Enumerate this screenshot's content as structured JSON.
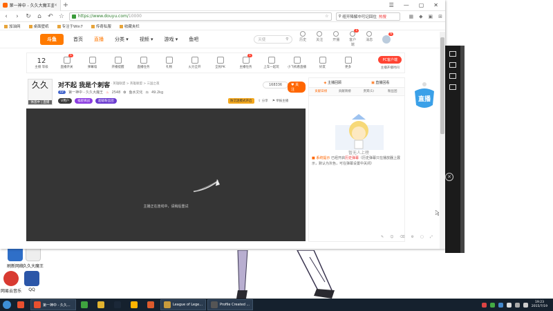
{
  "browser": {
    "tab_title": "第一神中 - 久久大魔王直播_斗鱼...",
    "new_tab": "+",
    "url_host": "https://www.douyu.com/",
    "url_path": "10000",
    "search_text": "纽开降解中可记回住",
    "search_hot": "热搜",
    "bookmarks": [
      "加油网",
      "桌面壁纸",
      "专注于Win7",
      "传奇私服",
      "收藏夹栏"
    ]
  },
  "site": {
    "logo_text": "斗鱼",
    "nav": [
      "首页",
      "直播",
      "分类 ▾",
      "视频 ▾",
      "游戏 ▾",
      "鱼吧"
    ],
    "search_placeholder": "天使",
    "header_icons": [
      {
        "label": "历史",
        "badge": ""
      },
      {
        "label": "关注",
        "badge": ""
      },
      {
        "label": "开播",
        "badge": ""
      },
      {
        "label": "客户端",
        "badge": "1"
      },
      {
        "label": "消息",
        "badge": ""
      }
    ],
    "avatar_badge": "6"
  },
  "toolbar": {
    "level_num": "12",
    "level_label": "主播 等级",
    "tools": [
      {
        "label": "直播开关",
        "badge": "1"
      },
      {
        "label": "弹幕墙",
        "badge": ""
      },
      {
        "label": "开播提醒",
        "badge": ""
      },
      {
        "label": "直播任务",
        "badge": ""
      },
      {
        "label": "礼物",
        "badge": ""
      },
      {
        "label": "火力全开",
        "badge": ""
      },
      {
        "label": "全民PK",
        "badge": ""
      },
      {
        "label": "主播任务",
        "badge": "1"
      },
      {
        "label": "上车一起玩",
        "badge": ""
      },
      {
        "label": "小飞机看直播",
        "badge": ""
      },
      {
        "label": "好友",
        "badge": ""
      },
      {
        "label": "更多",
        "badge": ""
      }
    ],
    "pc_button": "PC客户端",
    "pc_sub": "主播开播时间"
  },
  "room": {
    "avatar_chars": "久久",
    "avatar_status": "休息中 | 直播",
    "title": "对不起 我是个刺客",
    "categories": "举报 · 英雄联盟 > 英雄联盟 > 三国之夜",
    "level_tag": "LV",
    "streamer": "第一神中 - 久久大魔王",
    "heat": "2548",
    "fish": "鱼水文化",
    "weight": "49.2kg",
    "pill_v": "V用户",
    "pill_1": "福星挑战",
    "pill_2": "超级粉丝团",
    "follow_count": "168336",
    "follow_btn": "关注",
    "ban_label": "防沉迷模式开启",
    "share": "分享",
    "report": "举报主播"
  },
  "video": {
    "message": "主播正在连线中，请稍后重试"
  },
  "chat": {
    "top_left": "主播回顾",
    "top_right": "直播回看",
    "tabs": [
      "贡献日榜",
      "贡献周榜",
      "贵宾(1)",
      "粉丝团"
    ],
    "mascot_text": "暂无人上榜",
    "sys_tag": "系统提示",
    "sys_text1": "已经开启",
    "sys_highlight": "历史弹幕",
    "sys_text2": "（历史弹幕只在播放器上展示，默认为灰色，可在弹幕设置中关闭）"
  },
  "desktop": {
    "icons": [
      {
        "label": "刷新网络",
        "color": "#2f6fc8"
      },
      {
        "label": "久久大魔王",
        "color": "#fff"
      },
      {
        "label": "网易云音乐",
        "color": "#d83a31"
      },
      {
        "label": "QQ",
        "color": "#2b56a8"
      }
    ],
    "float_badge": "直播"
  },
  "taskbar": {
    "items": [
      {
        "label": "",
        "color": "#e8502f",
        "wide": false
      },
      {
        "label": "第一神中 - 久久...",
        "color": "#e8502f",
        "wide": true
      },
      {
        "label": "",
        "color": "#3fa33f",
        "wide": false
      },
      {
        "label": "",
        "color": "#e2b32f",
        "wide": false
      },
      {
        "label": "",
        "color": "#1b2838",
        "wide": false
      },
      {
        "label": "",
        "color": "#ffb400",
        "wide": false
      },
      {
        "label": "",
        "color": "#dd5b2d",
        "wide": false
      },
      {
        "label": "League of Lege...",
        "color": "#c89b3c",
        "wide": true
      },
      {
        "label": "Profile Created ...",
        "color": "#555",
        "wide": true
      }
    ],
    "time": "19:23",
    "date": "2015/7/19"
  }
}
